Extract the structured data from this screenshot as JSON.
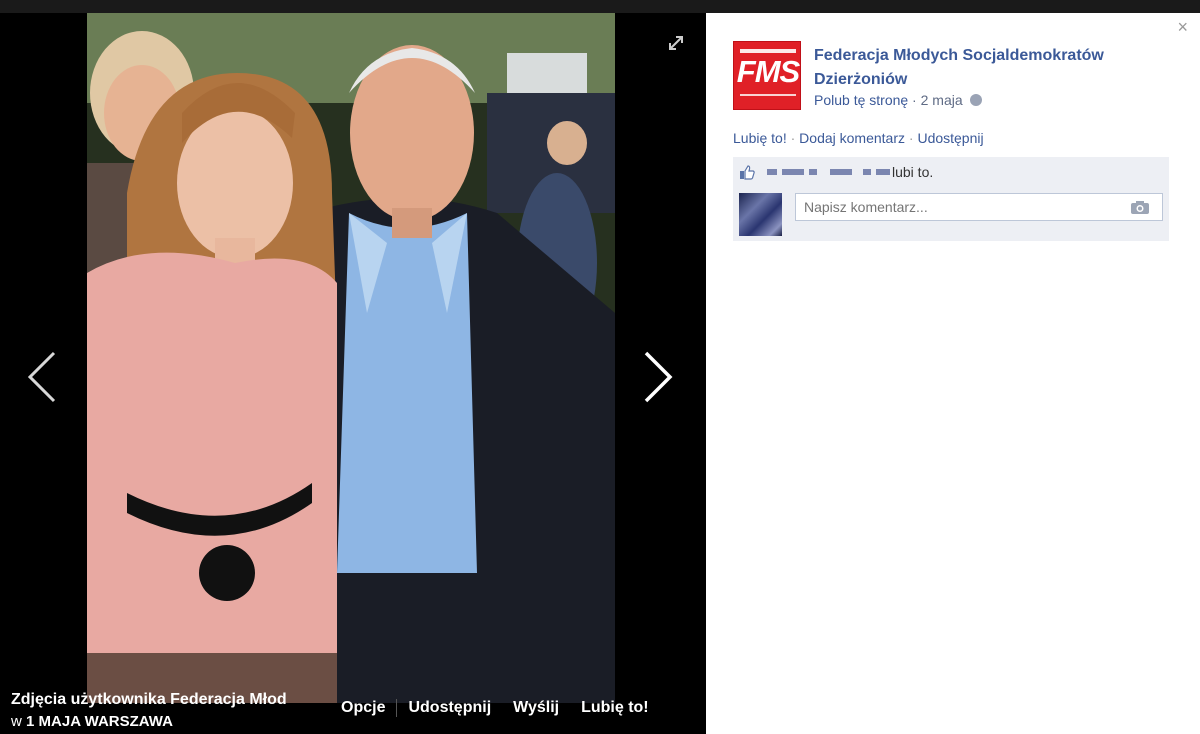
{
  "photo_caption": {
    "title": "Zdjęcia użytkownika Federacja Młod",
    "prefix": "w",
    "album": "1 MAJA WARSZAWA"
  },
  "photo_actions": [
    "Opcje",
    "Udostępnij",
    "Wyślij",
    "Lubię to!"
  ],
  "sidebar": {
    "close": "×",
    "page_name": "Federacja Młodych Socjaldemokratów Dzierżoniów",
    "logo_text": "FMS",
    "like_page": "Polub tę stronę",
    "meta_sep": " · ",
    "date": "2 maja",
    "actions": {
      "like": "Lubię to!",
      "comment": "Dodaj komentarz",
      "share": "Udostępnij",
      "separator": " · "
    },
    "likes_text": "lubi to.",
    "comment_placeholder": "Napisz komentarz..."
  },
  "icons": {
    "prev": "chevron-left-icon",
    "next": "chevron-right-icon",
    "expand": "fullscreen-icon",
    "like": "thumbs-up-icon",
    "camera": "camera-icon",
    "globe": "globe-icon"
  },
  "colors": {
    "link": "#3b5998",
    "logo": "#e02027",
    "ufi_bg": "#edeff4"
  }
}
